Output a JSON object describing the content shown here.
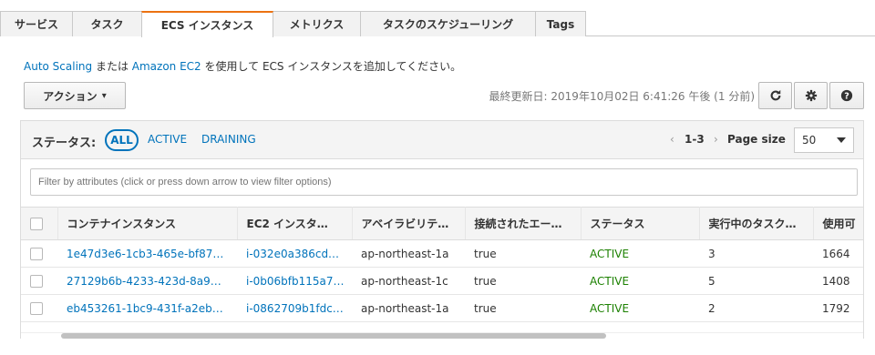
{
  "tabs": [
    {
      "label": "サービス",
      "active": false
    },
    {
      "label": "タスク",
      "active": false
    },
    {
      "label": "ECS インスタンス",
      "active": true
    },
    {
      "label": "メトリクス",
      "active": false
    },
    {
      "label": "タスクのスケジューリング",
      "active": false
    },
    {
      "label": "Tags",
      "active": false
    }
  ],
  "hint": {
    "link1": "Auto Scaling",
    "text1": " または ",
    "link2": "Amazon EC2",
    "text2": " を使用して ECS インスタンスを追加してください。"
  },
  "toolbar": {
    "actions_label": "アクション",
    "actions_caret": "▾",
    "last_updated": "最終更新日: 2019年10月02日 6:41:26 午後 (1 分前)",
    "refresh_icon": "refresh-icon",
    "settings_icon": "gear-icon",
    "help_icon": "help-icon"
  },
  "status_bar": {
    "label": "ステータス:",
    "all": "ALL",
    "active": "ACTIVE",
    "draining": "DRAINING",
    "pager_prev": "‹",
    "pager_range": "1-3",
    "pager_next": "›",
    "page_size_label": "Page size",
    "page_size_value": "50"
  },
  "filter": {
    "placeholder": "Filter by attributes (click or press down arrow to view filter options)"
  },
  "table": {
    "columns": [
      "コンテナインスタンス",
      "EC2 インスタ…",
      "アベイラビリテ…",
      "接続されたエー…",
      "ステータス",
      "実行中のタスク…",
      "使用可"
    ],
    "rows": [
      [
        "1e47d3e6-1cb3-465e-bf87…",
        "i-032e0a386cd…",
        "ap-northeast-1a",
        "true",
        "ACTIVE",
        "3",
        "1664"
      ],
      [
        "27129b6b-4233-423d-8a9…",
        "i-0b06bfb115a7…",
        "ap-northeast-1c",
        "true",
        "ACTIVE",
        "5",
        "1408"
      ],
      [
        "eb453261-1bc9-431f-a2eb…",
        "i-0862709b1fdc…",
        "ap-northeast-1a",
        "true",
        "ACTIVE",
        "2",
        "1792"
      ]
    ]
  },
  "colors": {
    "accent": "#ec7211",
    "link": "#0073bb",
    "active_status": "#1d8102"
  }
}
